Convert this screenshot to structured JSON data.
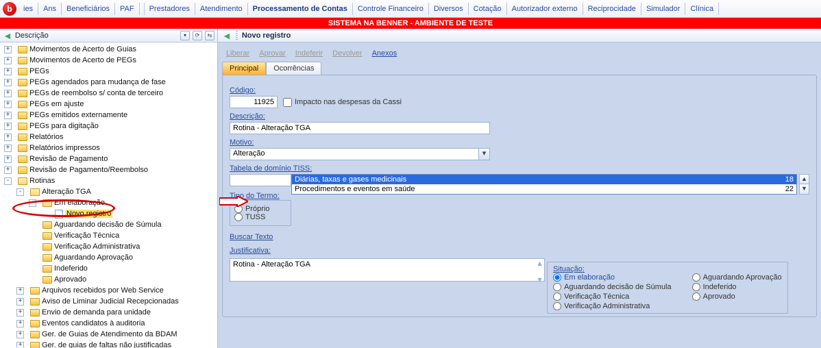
{
  "menu": {
    "items": [
      "ies",
      "Ans",
      "Beneficiários",
      "PAF",
      "Prestadores",
      "Atendimento",
      "Processamento de Contas",
      "Controle Financeiro",
      "Diversos",
      "Cotação",
      "Autorizador externo",
      "Reciprocidade",
      "Simulador",
      "Clínica"
    ],
    "active_index": 6
  },
  "banner": "SISTEMA NA BENNER - AMBIENTE DE TESTE",
  "left_panel": {
    "title": "Descrição"
  },
  "tree": [
    {
      "depth": 0,
      "exp": "+",
      "icon": "folder",
      "label": "Movimentos de Acerto de Guias"
    },
    {
      "depth": 0,
      "exp": "+",
      "icon": "folder",
      "label": "Movimentos de Acerto de PEGs"
    },
    {
      "depth": 0,
      "exp": "+",
      "icon": "folder",
      "label": "PEGs"
    },
    {
      "depth": 0,
      "exp": "+",
      "icon": "folder",
      "label": "PEGs agendados para mudança de fase"
    },
    {
      "depth": 0,
      "exp": "+",
      "icon": "folder",
      "label": "PEGs de reembolso s/ conta de terceiro"
    },
    {
      "depth": 0,
      "exp": "+",
      "icon": "folder",
      "label": "PEGs em ajuste"
    },
    {
      "depth": 0,
      "exp": "+",
      "icon": "folder",
      "label": "PEGs emitidos externamente"
    },
    {
      "depth": 0,
      "exp": "+",
      "icon": "folder",
      "label": "PEGs para digitação"
    },
    {
      "depth": 0,
      "exp": "+",
      "icon": "folder",
      "label": "Relatórios"
    },
    {
      "depth": 0,
      "exp": "+",
      "icon": "folder",
      "label": "Relatórios impressos"
    },
    {
      "depth": 0,
      "exp": "+",
      "icon": "folder",
      "label": "Revisão de Pagamento"
    },
    {
      "depth": 0,
      "exp": "+",
      "icon": "folder",
      "label": "Revisão de Pagamento/Reembolso"
    },
    {
      "depth": 0,
      "exp": "-",
      "icon": "folder-open",
      "label": "Rotinas"
    },
    {
      "depth": 1,
      "exp": "-",
      "icon": "folder-open",
      "label": "Alteração TGA"
    },
    {
      "depth": 2,
      "exp": "-",
      "icon": "folder-open",
      "label": "Em elaboração"
    },
    {
      "depth": 3,
      "exp": "",
      "icon": "file",
      "label": "Novo registro",
      "hilite": true
    },
    {
      "depth": 2,
      "exp": "",
      "icon": "folder",
      "label": "Aguardando decisão de Súmula"
    },
    {
      "depth": 2,
      "exp": "",
      "icon": "folder",
      "label": "Verificação Técnica"
    },
    {
      "depth": 2,
      "exp": "",
      "icon": "folder",
      "label": "Verificação Administrativa"
    },
    {
      "depth": 2,
      "exp": "",
      "icon": "folder",
      "label": "Aguardando Aprovação"
    },
    {
      "depth": 2,
      "exp": "",
      "icon": "folder",
      "label": "Indeferido"
    },
    {
      "depth": 2,
      "exp": "",
      "icon": "folder",
      "label": "Aprovado"
    },
    {
      "depth": 1,
      "exp": "+",
      "icon": "folder",
      "label": "Arquivos recebidos por Web Service"
    },
    {
      "depth": 1,
      "exp": "+",
      "icon": "folder",
      "label": "Aviso de Liminar Judicial Recepcionadas"
    },
    {
      "depth": 1,
      "exp": "+",
      "icon": "folder",
      "label": "Envio de demanda para unidade"
    },
    {
      "depth": 1,
      "exp": "+",
      "icon": "folder",
      "label": "Eventos candidatos à auditoria"
    },
    {
      "depth": 1,
      "exp": "+",
      "icon": "folder",
      "label": "Ger. de Guias de Atendimento da BDAM"
    },
    {
      "depth": 1,
      "exp": "+",
      "icon": "folder",
      "label": "Ger. de guias de faltas não justificadas"
    }
  ],
  "right_header": "Novo registro",
  "actions": {
    "liberar": "Liberar",
    "aprovar": "Aprovar",
    "indeferir": "Indeferir",
    "devolver": "Devolver",
    "anexos": "Anexos"
  },
  "tabs": {
    "principal": "Principal",
    "ocorrencias": "Ocorrências"
  },
  "form": {
    "codigo_label": "Código:",
    "codigo_value": "11925",
    "impacto_label": "Impacto nas despesas da Cassi",
    "descricao_label": "Descrição:",
    "descricao_value": "Rotina - Alteração TGA",
    "motivo_label": "Motivo:",
    "motivo_value": "Alteração",
    "tiss_label": "Tabela de domínio TISS:",
    "tiss_options": [
      {
        "label": "Diárias, taxas e gases medicinais",
        "code": "18",
        "selected": true
      },
      {
        "label": "Procedimentos e eventos em saúde",
        "code": "22",
        "selected": false
      }
    ],
    "tipo_termo_label": "Tipo do Termo:",
    "tipo_proprio": "Próprio",
    "tipo_tuss": "TUSS",
    "buscar_texto": "Buscar Texto",
    "justificativa_label": "Justificativa:",
    "justificativa_value": "Rotina - Alteração TGA",
    "situacao_label": "Situação:",
    "situacao": {
      "em_elaboracao": "Em elaboração",
      "aguardando_sumula": "Aguardando decisão de Súmula",
      "verif_tecnica": "Verificação Técnica",
      "verif_admin": "Verificação Administrativa",
      "aguardando_aprov": "Aguardando Aprovação",
      "indeferido": "Indeferido",
      "aprovado": "Aprovado"
    }
  }
}
